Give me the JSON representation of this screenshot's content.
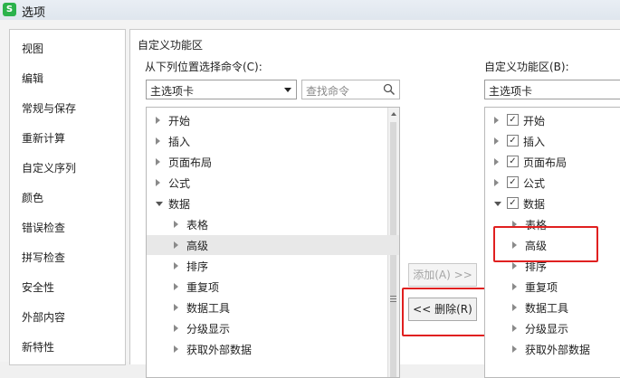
{
  "window": {
    "title": "选项",
    "icon": "wps-app-icon"
  },
  "sidebar": {
    "items": [
      {
        "label": "视图"
      },
      {
        "label": "编辑"
      },
      {
        "label": "常规与保存"
      },
      {
        "label": "重新计算"
      },
      {
        "label": "自定义序列"
      },
      {
        "label": "颜色"
      },
      {
        "label": "错误检查"
      },
      {
        "label": "拼写检查"
      },
      {
        "label": "安全性"
      },
      {
        "label": "外部内容"
      },
      {
        "label": "新特性"
      }
    ]
  },
  "panel": {
    "group_title": "自定义功能区",
    "left": {
      "label": "从下列位置选择命令(C):",
      "select_value": "主选项卡",
      "search_placeholder": "查找命令",
      "items": [
        {
          "label": "开始",
          "level": 0,
          "expanded": false
        },
        {
          "label": "插入",
          "level": 0,
          "expanded": false
        },
        {
          "label": "页面布局",
          "level": 0,
          "expanded": false
        },
        {
          "label": "公式",
          "level": 0,
          "expanded": false
        },
        {
          "label": "数据",
          "level": 0,
          "expanded": true
        },
        {
          "label": "表格",
          "level": 1,
          "expanded": false
        },
        {
          "label": "高级",
          "level": 1,
          "expanded": false,
          "selected": true
        },
        {
          "label": "排序",
          "level": 1,
          "expanded": false
        },
        {
          "label": "重复项",
          "level": 1,
          "expanded": false
        },
        {
          "label": "数据工具",
          "level": 1,
          "expanded": false
        },
        {
          "label": "分级显示",
          "level": 1,
          "expanded": false
        },
        {
          "label": "获取外部数据",
          "level": 1,
          "expanded": false
        }
      ]
    },
    "buttons": {
      "add": "添加(A) >>",
      "remove": "<< 删除(R)"
    },
    "right": {
      "label": "自定义功能区(B):",
      "select_value": "主选项卡",
      "items": [
        {
          "label": "开始",
          "level": 0,
          "expanded": false,
          "checked": true
        },
        {
          "label": "插入",
          "level": 0,
          "expanded": false,
          "checked": true
        },
        {
          "label": "页面布局",
          "level": 0,
          "expanded": false,
          "checked": true
        },
        {
          "label": "公式",
          "level": 0,
          "expanded": false,
          "checked": true
        },
        {
          "label": "数据",
          "level": 0,
          "expanded": true,
          "checked": true
        },
        {
          "label": "表格",
          "level": 1,
          "expanded": false
        },
        {
          "label": "高级",
          "level": 1,
          "expanded": false
        },
        {
          "label": "排序",
          "level": 1,
          "expanded": false
        },
        {
          "label": "重复项",
          "level": 1,
          "expanded": false
        },
        {
          "label": "数据工具",
          "level": 1,
          "expanded": false
        },
        {
          "label": "分级显示",
          "level": 1,
          "expanded": false
        },
        {
          "label": "获取外部数据",
          "level": 1,
          "expanded": false
        }
      ]
    }
  },
  "colors": {
    "highlight_box": "#e02020",
    "app_icon": "#2bb24c"
  }
}
